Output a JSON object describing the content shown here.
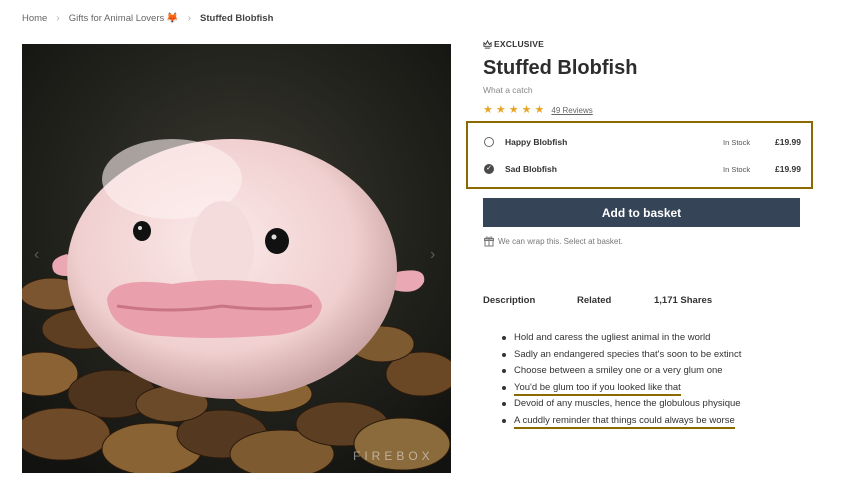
{
  "breadcrumb": {
    "home": "Home",
    "category": "Gifts for Animal Lovers",
    "current": "Stuffed Blobfish"
  },
  "gallery": {
    "watermark": "FIREBOX"
  },
  "product": {
    "badge": "EXCLUSIVE",
    "title": "Stuffed Blobfish",
    "subtitle": "What a catch",
    "rating_stars": 5,
    "reviews": "49 Reviews"
  },
  "variants": [
    {
      "name": "Happy Blobfish",
      "stock": "In Stock",
      "price": "£19.99",
      "selected": false
    },
    {
      "name": "Sad Blobfish",
      "stock": "In Stock",
      "price": "£19.99",
      "selected": true
    }
  ],
  "cta": {
    "add_label": "Add to basket"
  },
  "wrap_note": "We can wrap this. Select at basket.",
  "tabs": {
    "description": "Description",
    "related": "Related",
    "shares": "1,171 Shares"
  },
  "bullets": [
    "Hold and caress the ugliest animal in the world",
    "Sadly an endangered species that's soon to be extinct",
    "Choose between a smiley one or a very glum one",
    "You'd be glum too if you looked like that",
    "Devoid of any muscles, hence the globulous physique",
    "A cuddly reminder that things could always be worse"
  ],
  "colors": {
    "accent_border": "#8a6a00",
    "button": "#364458",
    "star": "#e6a52a"
  }
}
